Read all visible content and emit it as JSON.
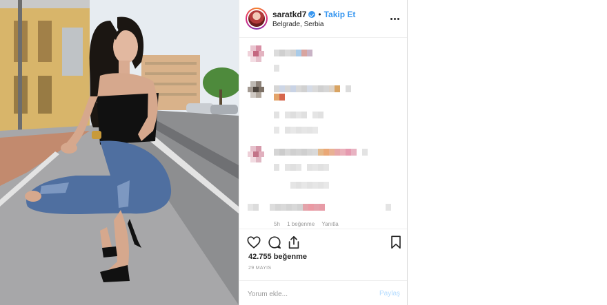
{
  "post": {
    "username": "saratkd7",
    "follow_label": "Takip Et",
    "separator": "•",
    "location": "Belgrade, Serbia",
    "likes": "42.755 beğenme",
    "date": "29 MAYIS",
    "comment_placeholder": "Yorum ekle...",
    "post_button": "Paylaş",
    "partial_meta": [
      "5h",
      "1 beğenme",
      "Yanıtla"
    ]
  },
  "icons": [
    "verified-badge-icon",
    "more-options-icon",
    "heart-icon",
    "comment-icon",
    "share-icon",
    "bookmark-icon"
  ],
  "colors": {
    "accent": "#3897f0",
    "text": "#262626",
    "muted": "#999999",
    "border": "#efefef",
    "post_disabled": "#b3dbff"
  }
}
